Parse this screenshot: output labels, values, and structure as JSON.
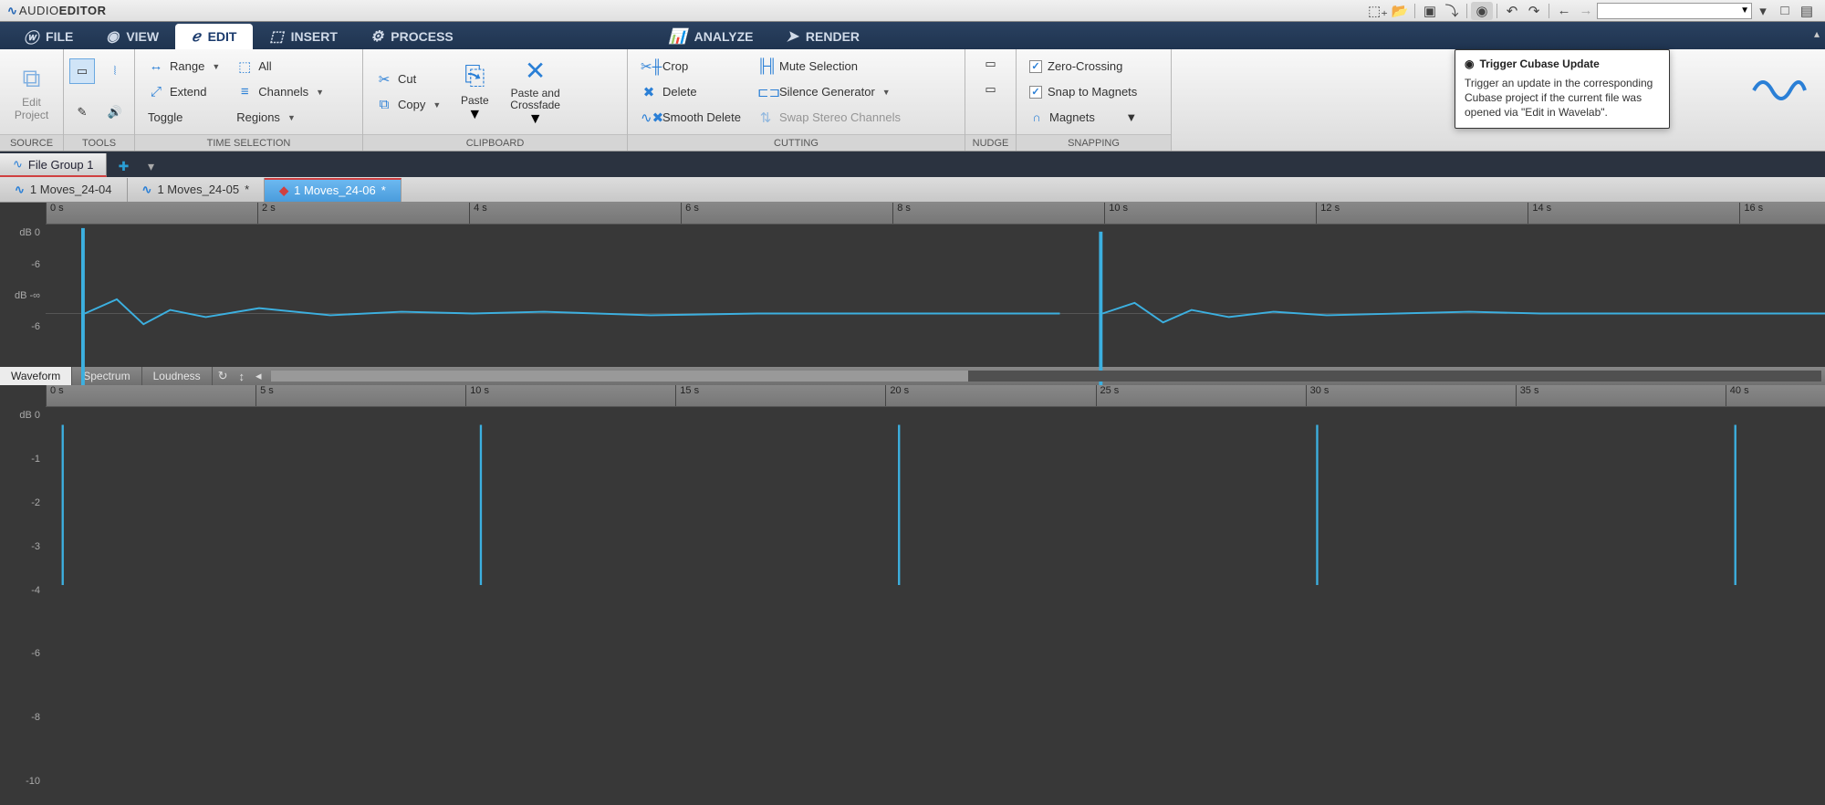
{
  "app_title": {
    "brand_prefix": "AUDIO",
    "brand_suffix": "EDITOR"
  },
  "ribbon": {
    "tabs": {
      "file": "FILE",
      "view": "VIEW",
      "edit": "EDIT",
      "insert": "INSERT",
      "process": "PROCESS",
      "analyze": "ANALYZE",
      "render": "RENDER"
    },
    "groups": {
      "source": {
        "label": "SOURCE",
        "edit_project": "Edit\nProject"
      },
      "tools": {
        "label": "TOOLS"
      },
      "time_selection": {
        "label": "TIME SELECTION",
        "range": "Range",
        "extend": "Extend",
        "toggle": "Toggle",
        "all": "All",
        "channels": "Channels",
        "regions": "Regions"
      },
      "clipboard": {
        "label": "CLIPBOARD",
        "cut": "Cut",
        "copy": "Copy",
        "paste": "Paste",
        "paste_crossfade": "Paste and\nCrossfade"
      },
      "cutting": {
        "label": "CUTTING",
        "crop": "Crop",
        "delete": "Delete",
        "smooth_delete": "Smooth Delete",
        "mute_selection": "Mute Selection",
        "silence_generator": "Silence Generator",
        "swap_stereo": "Swap Stereo Channels"
      },
      "nudge": {
        "label": "NUDGE"
      },
      "snapping": {
        "label": "SNAPPING",
        "zero_crossing": "Zero-Crossing",
        "snap_magnets": "Snap to Magnets",
        "magnets": "Magnets"
      }
    }
  },
  "tooltip": {
    "title": "Trigger Cubase Update",
    "body": "Trigger an update in the corresponding Cubase project if the current file was opened via \"Edit in Wavelab\"."
  },
  "file_group": {
    "name": "File Group 1"
  },
  "file_tabs": [
    {
      "name": "1 Moves_24-04",
      "modified": false,
      "active": false
    },
    {
      "name": "1 Moves_24-05",
      "modified": true,
      "active": false
    },
    {
      "name": "1 Moves_24-06",
      "modified": true,
      "active": true
    }
  ],
  "upper_view": {
    "ruler": [
      "0 s",
      "2 s",
      "4 s",
      "6 s",
      "8 s",
      "10 s",
      "12 s",
      "14 s",
      "16 s"
    ],
    "db": [
      "dB 0",
      "-6",
      "dB -∞",
      "-6"
    ],
    "view_tabs": {
      "waveform": "Waveform",
      "spectrum": "Spectrum",
      "loudness": "Loudness"
    }
  },
  "lower_view": {
    "ruler": [
      "0 s",
      "5 s",
      "10 s",
      "15 s",
      "20 s",
      "25 s",
      "30 s",
      "35 s",
      "40 s"
    ],
    "db": [
      "dB 0",
      "-1",
      "-2",
      "-3",
      "-4",
      "-6",
      "-8",
      "-10"
    ]
  }
}
